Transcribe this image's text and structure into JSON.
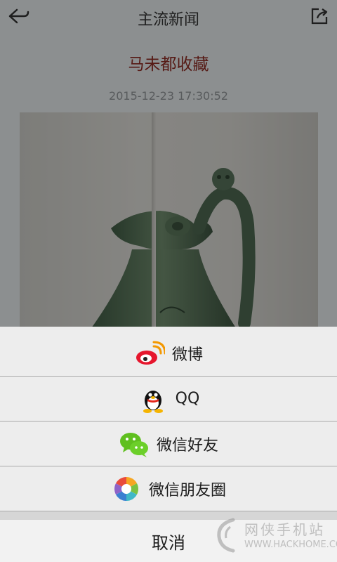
{
  "nav": {
    "title": "主流新闻",
    "back_icon": "back-arrow-icon",
    "share_icon": "share-icon"
  },
  "article": {
    "headline": "马未都收藏",
    "datetime": "2015-12-23 17:30:52",
    "image": "bronze-ewer-photo"
  },
  "share_sheet": {
    "options": [
      {
        "label": "微博",
        "icon": "weibo-icon"
      },
      {
        "label": "QQ",
        "icon": "qq-icon"
      },
      {
        "label": "微信好友",
        "icon": "wechat-icon"
      },
      {
        "label": "微信朋友圈",
        "icon": "moments-icon"
      }
    ],
    "cancel_label": "取消"
  },
  "watermark": {
    "cn": "网侠手机站",
    "en": "WWW.HACKHOME.COM"
  },
  "colors": {
    "headline": "#8b2a22",
    "sheet_bg": "#ececec",
    "divider": "#a9a9a9"
  }
}
